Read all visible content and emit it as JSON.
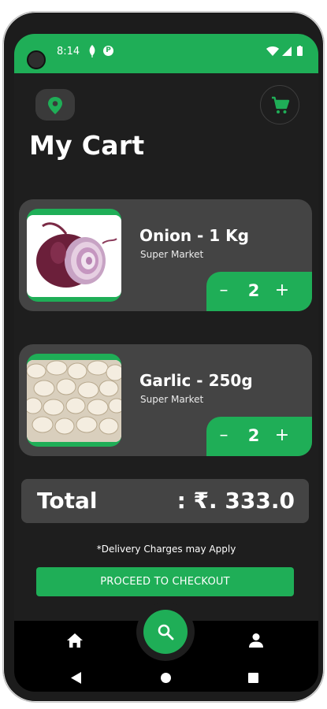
{
  "status_bar": {
    "time": "8:14",
    "p_badge": "P",
    "icons": [
      "leaf-icon",
      "p-badge-icon",
      "wifi-icon",
      "signal-icon",
      "battery-icon"
    ]
  },
  "header": {
    "title": "My Cart",
    "location_icon": "location-pin-icon",
    "cart_icon": "cart-icon"
  },
  "cart": {
    "items": [
      {
        "name": "Onion - 1 Kg",
        "store": "Super Market",
        "quantity": "2",
        "minus": "–",
        "plus": "+",
        "image": "onion"
      },
      {
        "name": "Garlic - 250g",
        "store": "Super Market",
        "quantity": "2",
        "minus": "–",
        "plus": "+",
        "image": "garlic"
      }
    ]
  },
  "total": {
    "label": "Total",
    "value": ": ₹. 333.0"
  },
  "delivery_note": "*Delivery Charges may Apply",
  "checkout": {
    "label": "PROCEED TO CHECKOUT"
  },
  "bottom_nav": {
    "items": [
      "home-icon",
      "search-icon",
      "profile-icon"
    ]
  },
  "system_nav": {
    "items": [
      "back-icon",
      "home-circle-icon",
      "recents-icon"
    ]
  },
  "colors": {
    "accent": "#1fae57",
    "background": "#1e1e1e",
    "card": "#444444"
  }
}
